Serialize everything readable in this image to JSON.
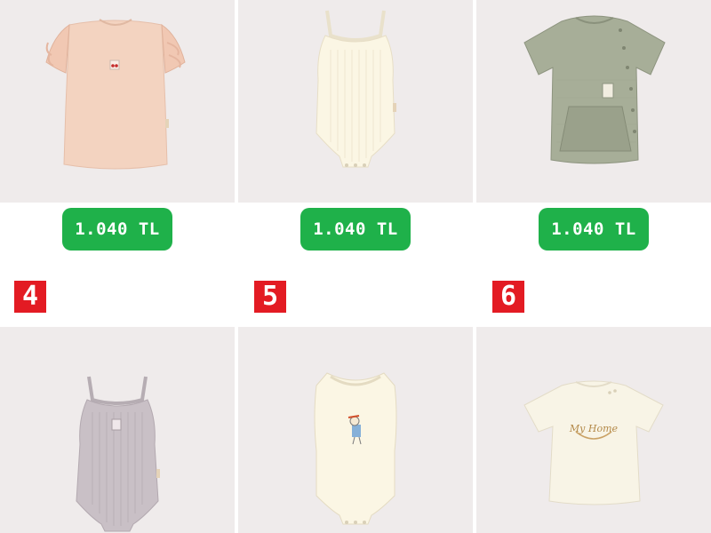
{
  "prices": [
    "1.040 TL",
    "1.040 TL",
    "1.040 TL"
  ],
  "numbers": [
    "4",
    "5",
    "6"
  ],
  "colors": {
    "tile_bg": "#efebeb",
    "price_bg": "#1fb14a",
    "number_bg": "#e31b23"
  },
  "products": [
    {
      "icon": "peach-ruffle-top-icon",
      "color": "#f3d3c0"
    },
    {
      "icon": "cream-bodysuit-icon",
      "color": "#fbf6e4"
    },
    {
      "icon": "green-tshirt-icon",
      "color": "#a7ae98"
    },
    {
      "icon": "lilac-bodysuit-icon",
      "color": "#c9c0c6"
    },
    {
      "icon": "cream-bodysuit-print-icon",
      "color": "#fbf6e4"
    },
    {
      "icon": "cream-tshirt-my-home-icon",
      "color": "#f8f4e6"
    }
  ],
  "print_text": {
    "my_home": "My Home"
  }
}
